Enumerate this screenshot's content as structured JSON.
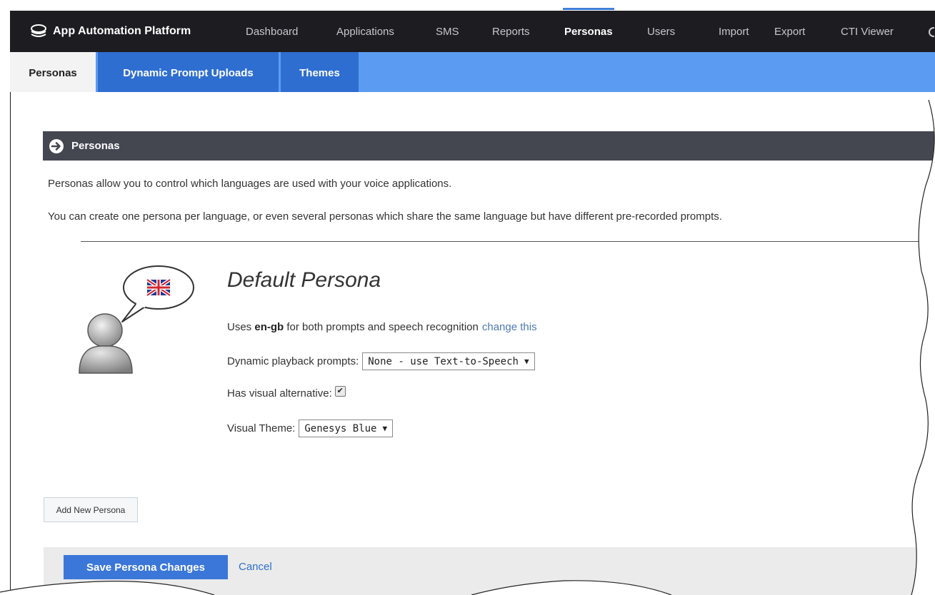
{
  "app": {
    "name": "App Automation Platform"
  },
  "topnav": {
    "items": [
      {
        "label": "Dashboard"
      },
      {
        "label": "Applications"
      },
      {
        "label": "SMS"
      },
      {
        "label": "Reports"
      },
      {
        "label": "Personas",
        "active": true
      },
      {
        "label": "Users"
      },
      {
        "label": "Import"
      },
      {
        "label": "Export"
      },
      {
        "label": "CTI Viewer"
      }
    ]
  },
  "subnav": {
    "tabs": [
      {
        "label": "Personas",
        "active": true
      },
      {
        "label": "Dynamic Prompt Uploads"
      },
      {
        "label": "Themes"
      }
    ]
  },
  "panel": {
    "title": "Personas",
    "intro_1": "Personas allow you to control which languages are used with your voice applications.",
    "intro_2": "You can create one persona per language, or even several personas which share the same language but have different pre-recorded prompts."
  },
  "persona": {
    "name": "Default Persona",
    "uses_prefix": "Uses",
    "language": "en-gb",
    "uses_suffix": "for both prompts and speech recognition",
    "change_link": "change this",
    "dynamic_label": "Dynamic playback prompts:",
    "dynamic_value": "None - use Text-to-Speech",
    "visual_alt_label": "Has visual alternative:",
    "visual_alt_checked": true,
    "theme_label": "Visual Theme:",
    "theme_value": "Genesys Blue"
  },
  "actions": {
    "add_new": "Add New Persona",
    "save": "Save Persona Changes",
    "cancel": "Cancel"
  },
  "colors": {
    "topnav_bg": "#1c1c21",
    "subnav_bg": "#5b9bf2",
    "subnav_active_dark": "#2f6ed1",
    "panel_header_bg": "#444650",
    "primary_button": "#3b77d9",
    "link": "#4f7ab0"
  },
  "icons": {
    "brand": "stacked-cloud-icon",
    "panel": "arrow-circle-right-icon",
    "flag": "uk-flag-icon",
    "avatar": "person-silhouette-icon",
    "speech": "speech-bubble-icon"
  }
}
